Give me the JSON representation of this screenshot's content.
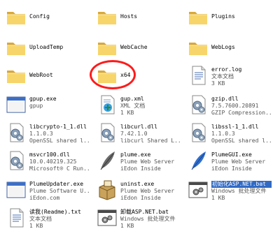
{
  "items": [
    {
      "name": "Config",
      "type": "folder",
      "icon": "folder-icon",
      "lines": []
    },
    {
      "name": "Hosts",
      "type": "folder",
      "icon": "folder-icon",
      "lines": []
    },
    {
      "name": "Plugins",
      "type": "folder",
      "icon": "folder-icon",
      "lines": []
    },
    {
      "name": "UploadTemp",
      "type": "folder",
      "icon": "folder-icon",
      "lines": []
    },
    {
      "name": "WebCache",
      "type": "folder",
      "icon": "folder-icon",
      "lines": []
    },
    {
      "name": "WebLogs",
      "type": "folder",
      "icon": "folder-icon",
      "lines": []
    },
    {
      "name": "WebRoot",
      "type": "folder",
      "icon": "folder-icon",
      "lines": []
    },
    {
      "name": "x64",
      "type": "folder",
      "icon": "folder-icon",
      "lines": []
    },
    {
      "name": "error.log",
      "type": "text",
      "icon": "text-document-icon",
      "lines": [
        "文本文档",
        "3 KB"
      ]
    },
    {
      "name": "gpup.exe",
      "type": "exe",
      "icon": "window-app-icon",
      "lines": [
        "gpup"
      ]
    },
    {
      "name": "gup.xml",
      "type": "xml",
      "icon": "xml-document-icon",
      "lines": [
        "XML 文档",
        "1 KB"
      ]
    },
    {
      "name": "gzip.dll",
      "type": "dll",
      "icon": "dll-gear-icon",
      "lines": [
        "7.5.7600.20891",
        "GZIP Compression..."
      ]
    },
    {
      "name": "libcrypto-1_1.dll",
      "type": "dll",
      "icon": "dll-gear-icon",
      "lines": [
        "1.1.0.3",
        "OpenSSL shared l..."
      ]
    },
    {
      "name": "libcurl.dll",
      "type": "dll",
      "icon": "dll-gear-icon",
      "lines": [
        "7.42.1.0",
        "libcurl Shared L..."
      ]
    },
    {
      "name": "libssl-1_1.dll",
      "type": "dll",
      "icon": "dll-gear-icon",
      "lines": [
        "1.1.0.3",
        "OpenSSL shared l..."
      ]
    },
    {
      "name": "msvcr100.dll",
      "type": "dll",
      "icon": "dll-gear-icon",
      "lines": [
        "10.0.40219.325",
        "Microsoft® C Run..."
      ]
    },
    {
      "name": "plume.exe",
      "type": "exe",
      "icon": "feather-icon",
      "lines": [
        "Plume Web Server",
        "iEdon Inside"
      ]
    },
    {
      "name": "PlumeGUI.exe",
      "type": "exe",
      "icon": "feather-blue-icon",
      "lines": [
        "Plume Web Server",
        "iEdon Inside"
      ]
    },
    {
      "name": "PlumeUpdater.exe",
      "type": "exe",
      "icon": "window-app-icon",
      "lines": [
        "Plume Software U...",
        "iEdon.com"
      ]
    },
    {
      "name": "uninst.exe",
      "type": "exe",
      "icon": "installer-box-icon",
      "lines": [
        "Plume Web Server",
        "iEdon Inside"
      ]
    },
    {
      "name": "初始化ASP.NET.bat",
      "type": "bat",
      "icon": "batch-file-icon",
      "lines": [
        "Windows 批处理文件",
        "1 KB"
      ],
      "selected": true
    },
    {
      "name": "读我(Readme).txt",
      "type": "text",
      "icon": "text-document-icon",
      "lines": [
        "文本文档",
        "1 KB"
      ]
    },
    {
      "name": "卸载ASP.NET.bat",
      "type": "bat",
      "icon": "batch-file-icon",
      "lines": [
        "Windows 批处理文件",
        "1 KB"
      ]
    }
  ],
  "colors": {
    "folder": "#f7d56a",
    "folder_dark": "#d9a83a",
    "selection": "#316ac5",
    "annotation": "#ff1a1a"
  }
}
